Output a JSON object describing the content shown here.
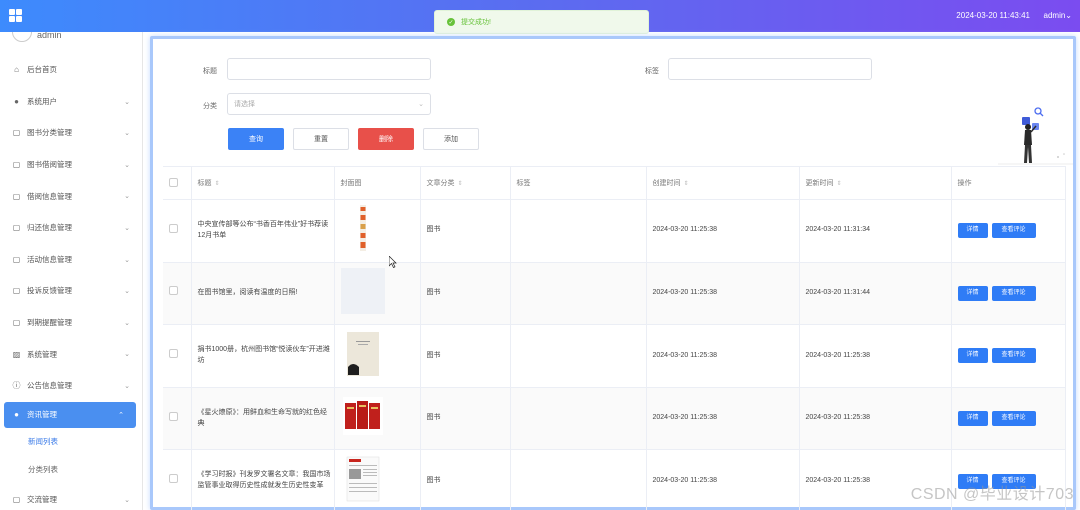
{
  "topbar": {
    "datetime": "2024-03-20 11:43:41",
    "user": "admin",
    "user_caret": "⌄"
  },
  "toast": {
    "message": "提交成功!"
  },
  "sidebar": {
    "username": "admin",
    "items": [
      {
        "label": "后台首页",
        "icon": "home-icon",
        "chevron": ""
      },
      {
        "label": "系统用户",
        "icon": "user-icon",
        "chevron": "⌄"
      },
      {
        "label": "图书分类管理",
        "icon": "doc-icon",
        "chevron": "⌄"
      },
      {
        "label": "图书借阅管理",
        "icon": "doc-icon",
        "chevron": "⌄"
      },
      {
        "label": "借阅信息管理",
        "icon": "doc-icon",
        "chevron": "⌄"
      },
      {
        "label": "归还信息管理",
        "icon": "doc-icon",
        "chevron": "⌄"
      },
      {
        "label": "活动信息管理",
        "icon": "doc-icon",
        "chevron": "⌄"
      },
      {
        "label": "投诉反馈管理",
        "icon": "doc-icon",
        "chevron": "⌄"
      },
      {
        "label": "到期提醒管理",
        "icon": "doc-icon",
        "chevron": "⌄"
      },
      {
        "label": "系统管理",
        "icon": "image-icon",
        "chevron": "⌄"
      },
      {
        "label": "公告信息管理",
        "icon": "info-icon",
        "chevron": "⌄"
      },
      {
        "label": "资讯管理",
        "icon": "location-icon",
        "chevron": "⌃"
      }
    ],
    "subitems": [
      {
        "label": "新闻列表"
      },
      {
        "label": "分类列表"
      }
    ],
    "last_item": {
      "label": "交流管理",
      "chevron": "⌄"
    }
  },
  "filters": {
    "title_label": "标题",
    "title_value": "",
    "tag_label": "标签",
    "tag_value": "",
    "category_label": "分类",
    "category_placeholder": "请选择",
    "buttons": {
      "query": "查询",
      "reset": "重置",
      "delete": "删除",
      "add": "添加"
    }
  },
  "table": {
    "headers": [
      "标题",
      "封面图",
      "文章分类",
      "标签",
      "创建时间",
      "更新时间",
      "操作"
    ],
    "sort_mark": "⇕",
    "rows": [
      {
        "title": "中央宣传部等公布“书香百年伟业”好书荐读12月书单",
        "category": "图书",
        "tag": "",
        "created": "2024-03-20 11:25:38",
        "updated": "2024-03-20 11:31:34",
        "btn1": "详情",
        "btn2": "查看评论"
      },
      {
        "title": "在图书馆里，阅读有温度的日照!",
        "category": "图书",
        "tag": "",
        "created": "2024-03-20 11:25:38",
        "updated": "2024-03-20 11:31:44",
        "btn1": "详情",
        "btn2": "查看评论"
      },
      {
        "title": "捐书1000册，杭州图书馆“悦读伙车”开进潍坊",
        "category": "图书",
        "tag": "",
        "created": "2024-03-20 11:25:38",
        "updated": "2024-03-20 11:25:38",
        "btn1": "详情",
        "btn2": "查看评论"
      },
      {
        "title": "《星火燎原》：用鲜血和生命写就的红色经典",
        "category": "图书",
        "tag": "",
        "created": "2024-03-20 11:25:38",
        "updated": "2024-03-20 11:25:38",
        "btn1": "详情",
        "btn2": "查看评论"
      },
      {
        "title": "《学习时报》刊发罗文署名文章：我国市场监管事业取得历史性成就发生历史性变革",
        "category": "图书",
        "tag": "",
        "created": "2024-03-20 11:25:38",
        "updated": "2024-03-20 11:25:38",
        "btn1": "详情",
        "btn2": "查看评论"
      }
    ]
  },
  "watermark": "CSDN @毕业设计703",
  "colors": {
    "primary": "#3b82f6",
    "danger": "#e8504a",
    "success": "#67c23a",
    "topbar_start": "#3d8bfd",
    "topbar_end": "#7b4cf0"
  }
}
